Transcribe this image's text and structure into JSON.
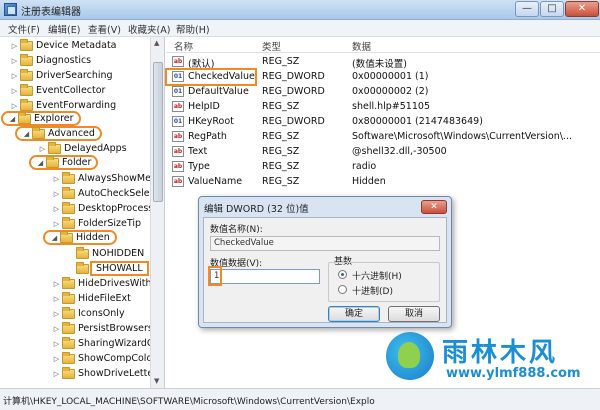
{
  "window": {
    "title": "注册表编辑器",
    "min": "—",
    "max": "□",
    "close": "✕"
  },
  "menu": [
    "文件(F)",
    "编辑(E)",
    "查看(V)",
    "收藏夹(A)",
    "帮助(H)"
  ],
  "tree": {
    "items": [
      {
        "label": "Device Metadata"
      },
      {
        "label": "Diagnostics"
      },
      {
        "label": "DriverSearching"
      },
      {
        "label": "EventCollector"
      },
      {
        "label": "EventForwarding"
      },
      {
        "label": "Explorer"
      },
      {
        "label": "Advanced"
      },
      {
        "label": "DelayedApps"
      },
      {
        "label": "Folder"
      },
      {
        "label": "AlwaysShowMenu"
      },
      {
        "label": "AutoCheckSelect"
      },
      {
        "label": "DesktopProcess"
      },
      {
        "label": "FolderSizeTip"
      },
      {
        "label": "Hidden"
      },
      {
        "label": "NOHIDDEN"
      },
      {
        "label": "SHOWALL"
      },
      {
        "label": "HideDrivesWithN"
      },
      {
        "label": "HideFileExt"
      },
      {
        "label": "IconsOnly"
      },
      {
        "label": "PersistBrowsers"
      },
      {
        "label": "SharingWizardOn"
      },
      {
        "label": "ShowCompColor"
      },
      {
        "label": "ShowDriveLetters"
      }
    ]
  },
  "list": {
    "headers": [
      "名称",
      "类型",
      "数据"
    ],
    "rows": [
      {
        "name": "(默认)",
        "type": "REG_SZ",
        "data": "(数值未设置)",
        "icon": "ab"
      },
      {
        "name": "CheckedValue",
        "type": "REG_DWORD",
        "data": "0x00000001 (1)",
        "icon": "dw"
      },
      {
        "name": "DefaultValue",
        "type": "REG_DWORD",
        "data": "0x00000002 (2)",
        "icon": "dw"
      },
      {
        "name": "HelpID",
        "type": "REG_SZ",
        "data": "shell.hlp#51105",
        "icon": "ab"
      },
      {
        "name": "HKeyRoot",
        "type": "REG_DWORD",
        "data": "0x80000001 (2147483649)",
        "icon": "dw"
      },
      {
        "name": "RegPath",
        "type": "REG_SZ",
        "data": "Software\\Microsoft\\Windows\\CurrentVersion\\...",
        "icon": "ab"
      },
      {
        "name": "Text",
        "type": "REG_SZ",
        "data": "@shell32.dll,-30500",
        "icon": "ab"
      },
      {
        "name": "Type",
        "type": "REG_SZ",
        "data": "radio",
        "icon": "ab"
      },
      {
        "name": "ValueName",
        "type": "REG_SZ",
        "data": "Hidden",
        "icon": "ab"
      }
    ]
  },
  "dialog": {
    "title": "编辑 DWORD (32 位)值",
    "close": "✕",
    "name_label": "数值名称(N):",
    "name_value": "CheckedValue",
    "data_label": "数值数据(V):",
    "data_value": "1",
    "base_label": "基数",
    "hex_label": "十六进制(H)",
    "dec_label": "十进制(D)",
    "ok": "确定",
    "cancel": "取消"
  },
  "status": {
    "path": "计算机\\HKEY_LOCAL_MACHINE\\SOFTWARE\\Microsoft\\Windows\\CurrentVersion\\Explo"
  },
  "watermark": {
    "name": "雨林木风",
    "url": "www.ylmf888.com"
  },
  "colors": {
    "highlight": "#f08a24",
    "logo": "#1a8fd3"
  }
}
